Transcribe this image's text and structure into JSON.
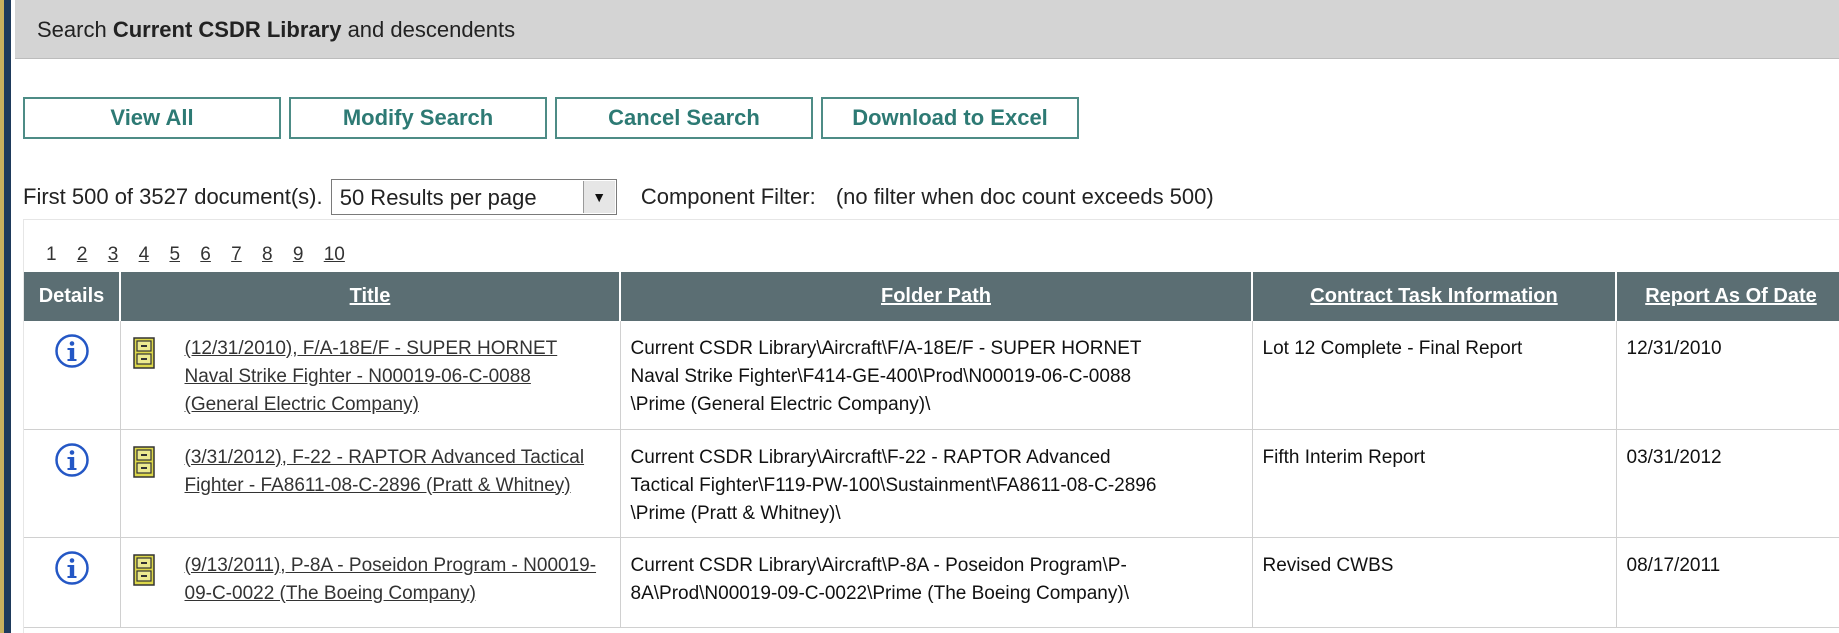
{
  "header": {
    "prefix": "Search",
    "library": "Current CSDR Library",
    "suffix": "and descendents"
  },
  "buttons": {
    "view_all": "View All",
    "modify_search": "Modify Search",
    "cancel_search": "Cancel Search",
    "download_excel": "Download to Excel"
  },
  "summary": {
    "count_text": "First 500 of 3527 document(s).",
    "per_page_selected": "50 Results per page",
    "component_filter_label": "Component Filter:",
    "component_filter_note": "(no filter when doc count exceeds 500)"
  },
  "pager": {
    "current": "1",
    "pages": [
      "2",
      "3",
      "4",
      "5",
      "6",
      "7",
      "8",
      "9",
      "10"
    ]
  },
  "table": {
    "columns": {
      "details": "Details",
      "title": "Title",
      "folder_path": "Folder Path",
      "contract_task": "Contract Task Information",
      "report_date": "Report As Of Date"
    },
    "rows": [
      {
        "title": "(12/31/2010), F/A-18E/F - SUPER HORNET Naval Strike Fighter - N00019-06-C-0088 (General Electric Company)",
        "folder_path_lines": [
          "Current CSDR Library\\Aircraft\\F/A-18E/F - SUPER HORNET",
          "Naval Strike Fighter\\F414-GE-400\\Prod\\N00019-06-C-0088",
          "\\Prime (General Electric Company)\\"
        ],
        "contract_task": "Lot 12 Complete - Final Report",
        "report_date": "12/31/2010"
      },
      {
        "title": "(3/31/2012), F-22 - RAPTOR Advanced Tactical Fighter - FA8611-08-C-2896 (Pratt & Whitney)",
        "folder_path_lines": [
          "Current CSDR Library\\Aircraft\\F-22 - RAPTOR Advanced",
          "Tactical Fighter\\F119-PW-100\\Sustainment\\FA8611-08-C-2896",
          "\\Prime (Pratt & Whitney)\\"
        ],
        "contract_task": "Fifth Interim Report",
        "report_date": "03/31/2012"
      },
      {
        "title": "(9/13/2011), P-8A - Poseidon Program - N00019-09-C-0022 (The Boeing Company)",
        "folder_path_lines": [
          "Current CSDR Library\\Aircraft\\P-8A - Poseidon Program\\P-",
          "8A\\Prod\\N00019-09-C-0022\\Prime (The Boeing Company)\\"
        ],
        "contract_task": "Revised CWBS",
        "report_date": "08/17/2011"
      }
    ]
  },
  "colors": {
    "header_bg": "#d4d4d4",
    "button_border": "#4d8c86",
    "button_text": "#2d7a74",
    "table_header_bg": "#5b6e73",
    "info_icon": "#2457c5",
    "frame_blue": "#1e3a5c"
  }
}
